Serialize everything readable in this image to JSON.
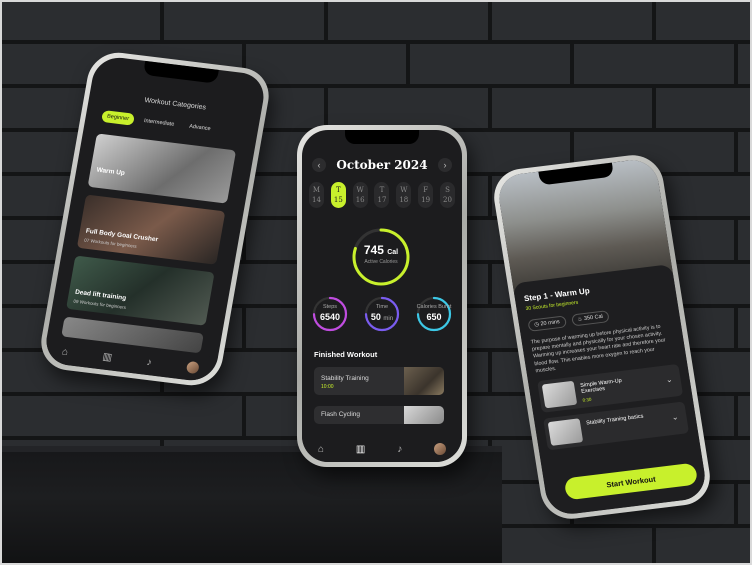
{
  "colors": {
    "accent": "#c8f02c",
    "background": "#1c1c1e"
  },
  "center": {
    "month": "October 2024",
    "days": [
      {
        "dow": "M",
        "num": "14"
      },
      {
        "dow": "T",
        "num": "15"
      },
      {
        "dow": "W",
        "num": "16"
      },
      {
        "dow": "T",
        "num": "17"
      },
      {
        "dow": "W",
        "num": "18"
      },
      {
        "dow": "F",
        "num": "19"
      },
      {
        "dow": "S",
        "num": "20"
      }
    ],
    "selected_day_index": 1,
    "calories": {
      "value": "745",
      "unit": "Cal",
      "label": "Active Calories"
    },
    "stats": [
      {
        "title": "Steps",
        "value": "6540",
        "unit": "",
        "color": "#c04ce0"
      },
      {
        "title": "Time",
        "value": "50",
        "unit": "min",
        "color": "#7a5cf0"
      },
      {
        "title": "Calories Burnt",
        "value": "650",
        "unit": "",
        "color": "#3cc8e6"
      }
    ],
    "finished_title": "Finished Workout",
    "finished": [
      {
        "name": "Stability Training",
        "time": "10:00"
      },
      {
        "name": "Flash Cycling",
        "time": ""
      }
    ]
  },
  "left": {
    "title": "Workout Categories",
    "tabs": [
      "Beginner",
      "Intermediate",
      "Advance"
    ],
    "cards": [
      {
        "name": "Warm Up",
        "sub": ""
      },
      {
        "name": "Full Body Goal Crusher",
        "sub": "07 Workouts for beginners"
      },
      {
        "name": "Dead lift training",
        "sub": "09 Workouts for beginners"
      }
    ]
  },
  "right": {
    "step": "Step 1 - Warm Up",
    "step_sub": "30 Scouts for beginners",
    "duration": "20 mins",
    "calories": "350 Cal",
    "description": "The purpose of warming up before physical activity is to prepare mentally and physically for your chosen activity. Warming up increases your heart rate and therefore your blood flow. This enables more oxygen to reach your muscles.",
    "exercises": [
      {
        "name": "Simple Warm-Up Exercises",
        "time": "0:30"
      },
      {
        "name": "Stability Training basics",
        "time": ""
      }
    ],
    "cta": "Start Workout"
  }
}
